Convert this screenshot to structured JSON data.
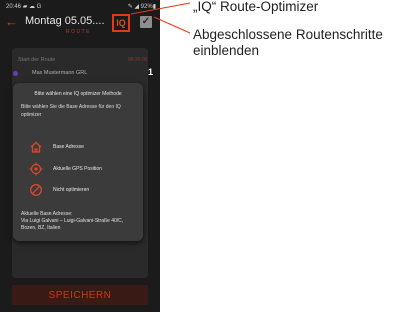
{
  "status_bar": {
    "time": "20:46",
    "left_icons": "▰ ☁ G",
    "right_info": "✎ ◢ 92%▮"
  },
  "header": {
    "back_icon": "arrow-left-icon",
    "title": "Montag 05.05....",
    "subtitle": "ROUTE",
    "iq_label": "IQ",
    "checkbox_glyph": "✓"
  },
  "route": {
    "start_label": "Start der Route",
    "start_time": "06:30:00",
    "item_label": "Max Mustermann GRL",
    "item_number": "1"
  },
  "dialog": {
    "title": "Bitte wählen eine IQ optimizer Methode",
    "body": "Bitte wählen Sie die Base Adresse für den IQ optimizer",
    "options": [
      {
        "label": "Base Adresse",
        "icon": "home-icon"
      },
      {
        "label": "Aktuelle GPS Position",
        "icon": "gps-crosshair-icon"
      },
      {
        "label": "Nicht optimieren",
        "icon": "prohibited-icon"
      }
    ],
    "footer_heading": "Aktuelle Base Adresse:",
    "footer_address": "Via Luigi Galvani – Luigi-Galvani-Straße 40/C, Bozen, BZ, Italien"
  },
  "save_label": "SPEICHERN",
  "annotations": {
    "iq": "„IQ“ Route-Optimizer",
    "steps_line1": "Abgeschlossene Routenschritte",
    "steps_line2": "einblenden"
  },
  "colors": {
    "accent": "#e03a16",
    "background": "#1b1b1b",
    "dialog": "#3b3b3b",
    "option_icon": "#d8482a"
  }
}
